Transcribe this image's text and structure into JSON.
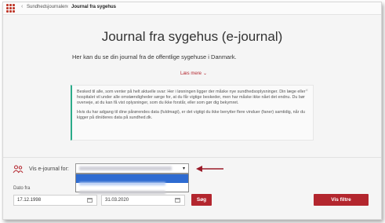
{
  "breadcrumb": {
    "parent": "Sundhedsjournalen",
    "current": "Journal fra sygehus"
  },
  "page": {
    "title": "Journal fra sygehus (e-journal)",
    "subtitle": "Her kan du se din journal fra de offentlige sygehuse i Danmark.",
    "read_more": "Læs mere"
  },
  "info": {
    "paragraph1": "Besked til alle, som venter på helt aktuelle svar: Her i løsningen ligger der måske nye sundhedsoplysninger.  Din læge eller hospitalet vil under alle omstændigheder sørge for, at du får vigtige beskeder, men har måske ikke nået det endnu. Du bør overveje, at du kan få vist oplysninger, som du ikke forstår, eller som gør dig bekymret.",
    "paragraph2": "Hvis du har adgang til dine pårørendes data (fuldmagt), er det vigtigt du ikke benytter flere vinduer (faner) samtidig, når du kigger på din/deres data på sundhed.dk.",
    "close_symbol": "×"
  },
  "filter": {
    "vis_label": "Vis e-journal for:",
    "date_label": "Dato fra",
    "date_from": "17.12.1998",
    "date_to": "31.03.2020",
    "search_button": "Søg",
    "filter_button": "Vis filtre"
  },
  "colors": {
    "accent": "#b3262e",
    "info_border": "#2bab8a",
    "selection": "#2e6bd1"
  }
}
